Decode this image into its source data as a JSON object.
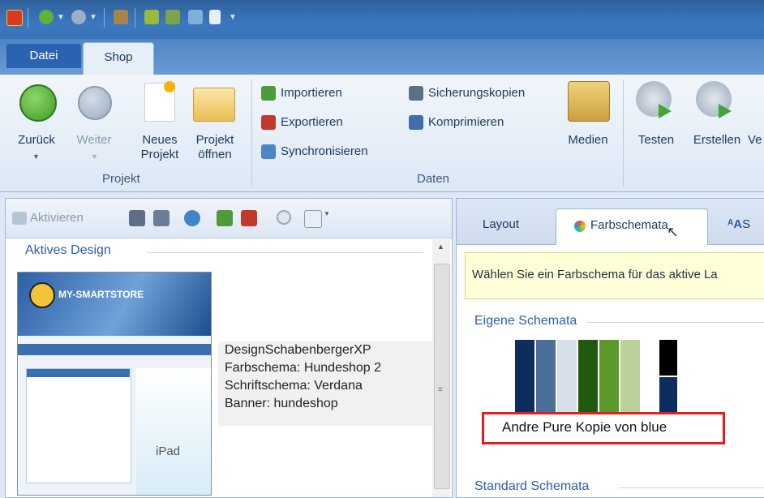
{
  "ribbon_tabs": {
    "file": "Datei",
    "shop": "Shop"
  },
  "ribbon": {
    "projekt_group": {
      "label": "Projekt",
      "back": "Zurück",
      "forward": "Weiter",
      "new_line1": "Neues",
      "new_line2": "Projekt",
      "open_line1": "Projekt",
      "open_line2": "öffnen"
    },
    "daten_group": {
      "label": "Daten",
      "import": "Importieren",
      "export": "Exportieren",
      "sync": "Synchronisieren",
      "backups": "Sicherungskopien",
      "compress": "Komprimieren",
      "media": "Medien"
    },
    "test": "Testen",
    "build": "Erstellen",
    "cut_label": "Ve"
  },
  "left_panel": {
    "activate": "Aktivieren",
    "section_title": "Aktives Design",
    "thumbnail_device_text": "iPad",
    "thumbnail_logo": "MY-SMARTSTORE",
    "info": {
      "design": "DesignSchabenbergerXP",
      "color_scheme": "Farbschema: Hundeshop 2",
      "font_scheme": "Schriftschema: Verdana",
      "banner": "Banner: hundeshop"
    }
  },
  "right_panel": {
    "tab_layout": "Layout",
    "tab_colors": "Farbschemata",
    "tab_fonts_cut": "S",
    "hint": "Wählen Sie ein Farbschema für das aktive La",
    "own_schemes_title": "Eigene Schemata",
    "scheme_name": "Andre Pure Kopie von blue",
    "standard_schemes_title": "Standard Schemata",
    "swatch_colors": [
      "#0d2d5e",
      "#4a6f99",
      "#d6dfe9",
      "#1f5a0f",
      "#5b9a2a",
      "#bcd19a"
    ],
    "swatch_dark_top": "#000000",
    "swatch_dark_bottom": "#0d2d5e"
  },
  "colors": {
    "ribbon_blue": "#3b78bf",
    "title_blue": "#2b5ea6",
    "highlight_red": "#e0201c",
    "hint_yellow": "#ffffd8"
  }
}
